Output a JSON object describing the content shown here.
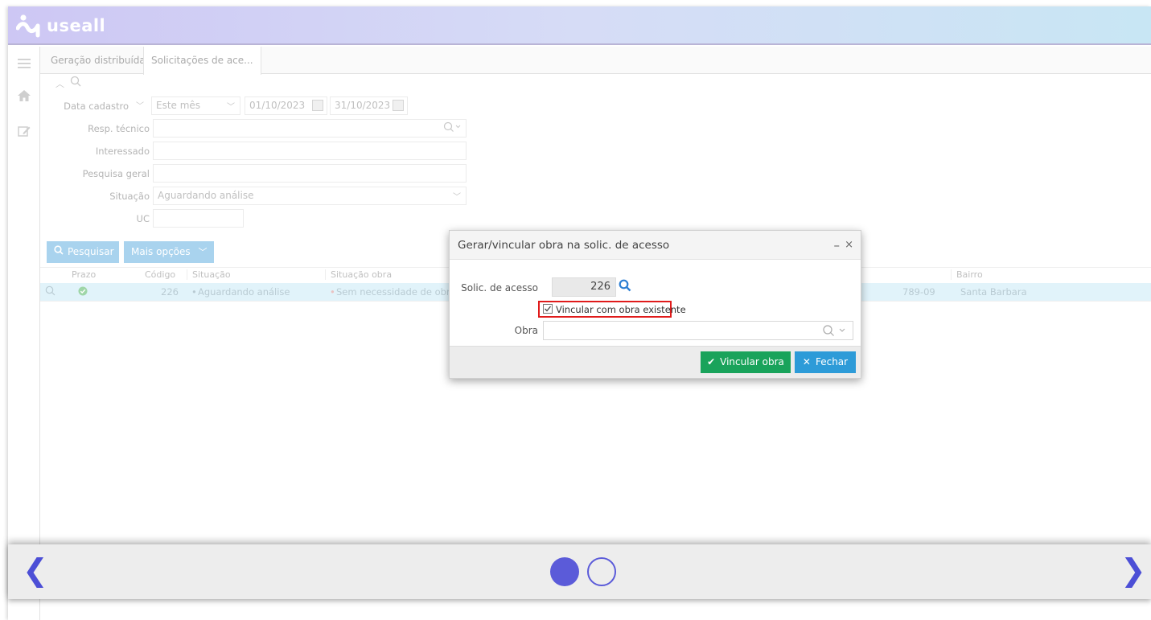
{
  "app": {
    "brand": "useall"
  },
  "tabs": [
    {
      "label": "Geração distribuída"
    },
    {
      "label": "Solicitações de ace..."
    }
  ],
  "filters": {
    "data_cadastro_label": "Data cadastro",
    "period_value": "Este mês",
    "date_start": "01/10/2023",
    "date_end": "31/10/2023",
    "resp_tecnico_label": "Resp. técnico",
    "interessado_label": "Interessado",
    "pesquisa_geral_label": "Pesquisa geral",
    "situacao_label": "Situação",
    "situacao_value": "Aguardando análise",
    "uc_label": "UC"
  },
  "buttons": {
    "pesquisar": "Pesquisar",
    "mais_opcoes": "Mais opções"
  },
  "grid": {
    "columns": [
      "Prazo",
      "Código",
      "Situação",
      "Situação obra",
      "Bairro"
    ],
    "rows": [
      {
        "codigo": "226",
        "situacao": "Aguardando análise",
        "situacao_obra": "Sem necessidade de obra",
        "partial": "789-09",
        "bairro": "Santa Barbara"
      }
    ]
  },
  "dialog": {
    "title": "Gerar/vincular obra na solic. de acesso",
    "solic_label": "Solic. de acesso",
    "solic_value": "226",
    "checkbox_label": "Vincular com obra existente",
    "checkbox_checked": true,
    "obra_label": "Obra",
    "obra_value": "",
    "vincular_button": "Vincular obra",
    "fechar_button": "Fechar",
    "minimize": "–",
    "close": "×"
  },
  "carousel": {
    "prev": "❮",
    "next": "❯",
    "total": 2,
    "active": 1
  },
  "colors": {
    "accent_blue": "#2d9bd8",
    "success_green": "#19a35b",
    "highlight_red": "#e01b1b",
    "carousel_purple": "#5b5bd9"
  }
}
